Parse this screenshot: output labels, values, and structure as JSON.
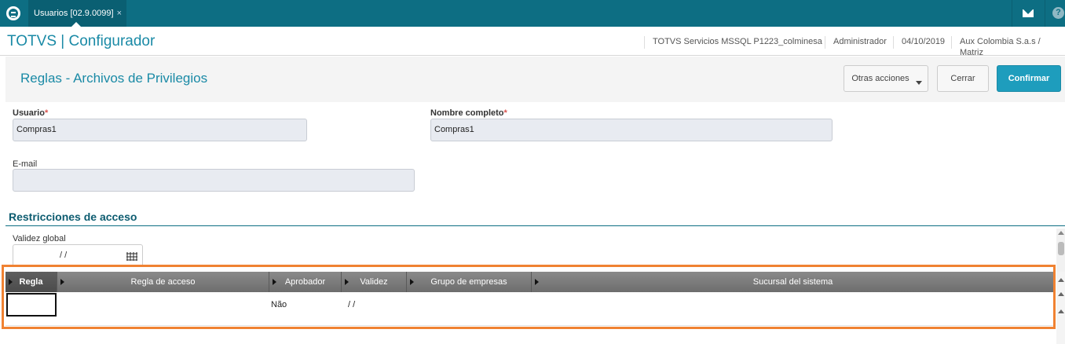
{
  "topbar": {
    "tab_label": "Usuarios [02.9.0099]",
    "tab_close": "×",
    "help_glyph": "?"
  },
  "header": {
    "app_title": "TOTVS | Configurador",
    "environment": "TOTVS Servicios MSSQL P1223_colminesa",
    "user": "Administrador",
    "date": "04/10/2019",
    "company": "Aux Colombia S.a.s / Matriz"
  },
  "titlebar": {
    "page_title": "Reglas - Archivos de Privilegios",
    "otras_label": "Otras acciones",
    "cerrar_label": "Cerrar",
    "confirmar_label": "Confirmar"
  },
  "form": {
    "usuario_label": "Usuario",
    "usuario_value": "Compras1",
    "nombre_label": "Nombre completo",
    "nombre_value": "Compras1",
    "required_mark": "*",
    "email_label": "E-mail",
    "email_value": ""
  },
  "restricciones": {
    "section_title": "Restricciones de acceso",
    "validez_label": "Validez global",
    "validez_value": "/ /"
  },
  "grid": {
    "columns": [
      "Regla",
      "Regla de acceso",
      "Aprobador",
      "Validez",
      "Grupo de empresas",
      "Sucursal del sistema"
    ],
    "rows": [
      {
        "regla": "",
        "regla_acceso": "",
        "aprobador": "Não",
        "validez": "/ /",
        "grupo": "",
        "sucursal": ""
      }
    ]
  },
  "colors": {
    "topbar": "#0d6e83",
    "accent": "#1a8aa6",
    "confirm": "#1e9dbd",
    "highlight": "#f08232"
  }
}
